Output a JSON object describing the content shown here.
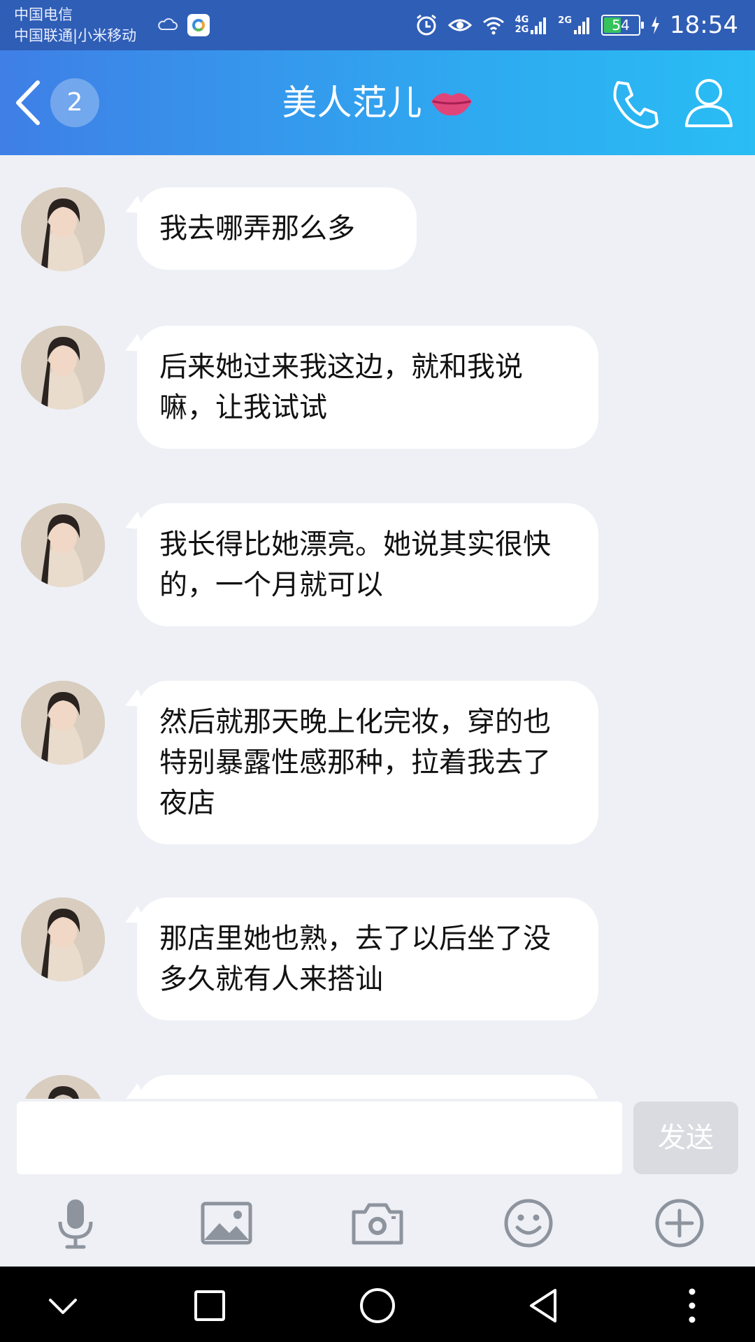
{
  "status_bar": {
    "carrier_line1": "中国电信",
    "carrier_line2": "中国联通|小米移动",
    "network_label_1": "4G",
    "network_label_2": "2G",
    "network_label_3": "2G",
    "battery_percent": "54",
    "battery_level": 0.54,
    "time": "18:54"
  },
  "header": {
    "unread_count": "2",
    "title": "美人范儿",
    "title_icon": "lips-icon",
    "gradient_start": "#3f7fe6",
    "gradient_end": "#29bdf4"
  },
  "messages": [
    {
      "text": "我去哪弄那么多"
    },
    {
      "text": "后来她过来我这边，就和我说嘛，让我试试"
    },
    {
      "text": "我长得比她漂亮。她说其实很快的，一个月就可以"
    },
    {
      "text": "然后就那天晚上化完妆，穿的也特别暴露性感那种，拉着我去了夜店"
    },
    {
      "text": "那店里她也熟，去了以后坐了没多久就有人来搭讪"
    }
  ],
  "input": {
    "value": "",
    "send_label": "发送"
  },
  "toolbar": {
    "icons": [
      "microphone-icon",
      "image-icon",
      "camera-icon",
      "emoji-icon",
      "plus-icon"
    ]
  },
  "nav": {
    "icons": [
      "chevron-down-icon",
      "square-icon",
      "circle-icon",
      "triangle-back-icon",
      "more-dots-icon"
    ]
  }
}
